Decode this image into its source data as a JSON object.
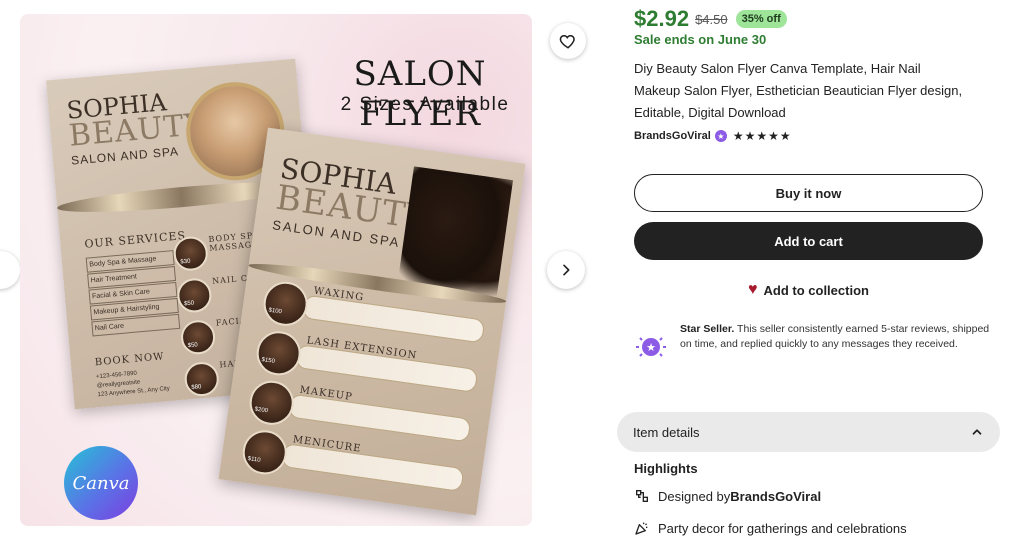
{
  "gallery": {
    "flyer": {
      "title": "SALON FLYER",
      "subtitle": "2 Sizes Available",
      "name_top": "SOPHIA",
      "name_bottom": "BEAUTY",
      "salon_tag": "SALON AND SPA",
      "our_services": "OUR SERVICES",
      "services": [
        "Body Spa & Massage",
        "Hair Treatment",
        "Facial & Skin Care",
        "Makeup & Hairstyling",
        "Nail Care"
      ],
      "book_now": "BOOK NOW",
      "contact": [
        "+123-456-7890",
        "@reallygreatsite",
        "123 Anywhere St., Any City"
      ],
      "back_services": [
        "BODY SPA & MASSAGE",
        "NAIL CARE",
        "FACIAL & SKIN CA",
        "HAIR TREAT"
      ],
      "back_prices": [
        "$30",
        "$50",
        "$50",
        "$80"
      ],
      "front_services": [
        "WAXING",
        "LASH EXTENSION",
        "MAKEUP",
        "MENICURE"
      ],
      "front_prices": [
        "$100",
        "$150",
        "$200",
        "$110"
      ],
      "canva_label": "Canva"
    },
    "favorite_icon": "heart-outline-icon",
    "next_icon": "chevron-right-icon"
  },
  "product": {
    "price": "$2.92",
    "original_price": "$4.50",
    "discount": "35% off",
    "sale_ends": "Sale ends on June 30",
    "title": "Diy Beauty Salon Flyer Canva Template, Hair Nail Makeup Salon Flyer, Esthetician Beautician Flyer design, Editable, Digital Download",
    "seller": "BrandsGoViral",
    "rating_stars": "★★★★★",
    "rating": 5
  },
  "actions": {
    "buy_now": "Buy it now",
    "add_to_cart": "Add to cart",
    "add_to_collection": "Add to collection"
  },
  "star_seller": {
    "label": "Star Seller.",
    "text": " This seller consistently earned 5-star reviews, shipped on time, and replied quickly to any messages they received."
  },
  "item_details": {
    "label": "Item details",
    "highlights_label": "Highlights",
    "highlights": [
      {
        "prefix": "Designed by ",
        "bold": "BrandsGoViral",
        "icon": "designer-icon"
      },
      {
        "prefix": "Party decor for gatherings and celebrations",
        "bold": "",
        "icon": "party-popper-icon"
      }
    ]
  },
  "colors": {
    "price_green": "#2e7d32",
    "discount_bg": "#9ee59a",
    "dark_button": "#222222",
    "heart_red": "#a61a2e",
    "star_seller_purple": "#8c5ce6"
  }
}
